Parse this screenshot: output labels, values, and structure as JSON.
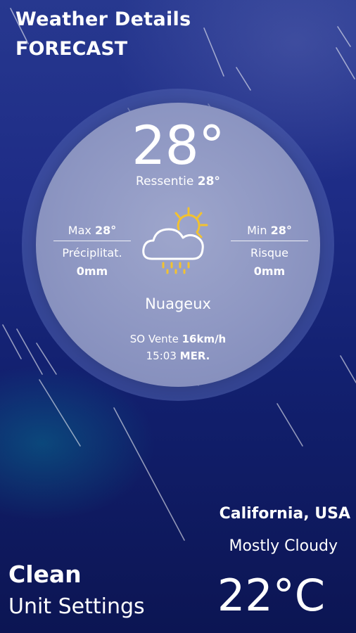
{
  "header": {
    "title": "Weather Details",
    "subtitle": "FORECAST"
  },
  "dial": {
    "temperature": "28°",
    "feels_label": "Ressentie",
    "feels_value": "28°",
    "max_label": "Max",
    "max_value": "28°",
    "min_label": "Min",
    "min_value": "28°",
    "precip_label": "Préciplitat.",
    "precip_value": "0mm",
    "risk_label": "Risque",
    "risk_value": "0mm",
    "condition": "Nuageux",
    "wind_label": "SO Vente",
    "wind_value": "16km/h",
    "time": "15:03",
    "day": "MER.",
    "icon": "cloud-sun-rain-icon"
  },
  "location": {
    "city": "California, USA",
    "description": "Mostly Cloudy",
    "temperature": "22°C"
  },
  "footer": {
    "title": "Clean",
    "subtitle": "Unit Settings"
  },
  "colors": {
    "background_top": "#27388f",
    "background_bottom": "#0c1553",
    "dial": "#9ea6cc",
    "sun": "#f2c230",
    "rain_drops": "#f2c230"
  }
}
